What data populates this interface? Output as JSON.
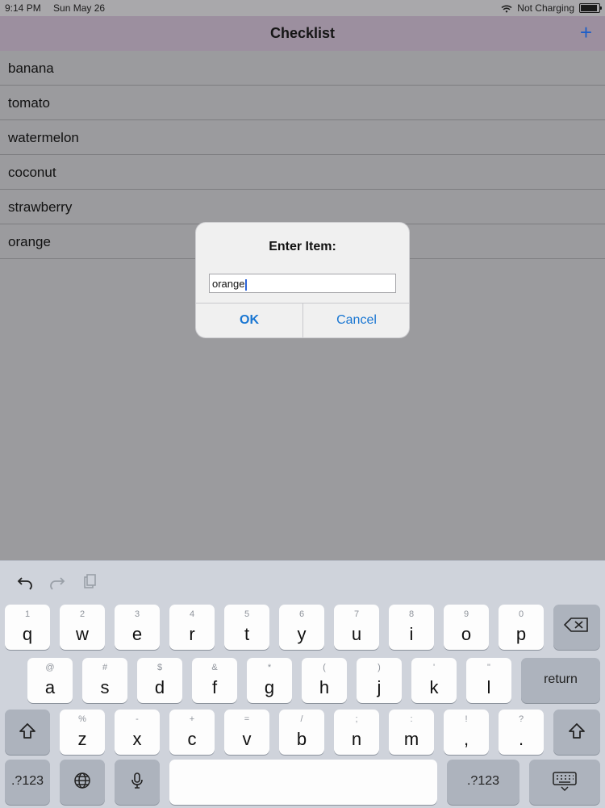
{
  "status": {
    "time": "9:14 PM",
    "date": "Sun May 26",
    "network": "Not Charging"
  },
  "nav": {
    "title": "Checklist",
    "add_label": "+"
  },
  "list": {
    "items": [
      "banana",
      "tomato",
      "watermelon",
      "coconut",
      "strawberry",
      "orange"
    ]
  },
  "dialog": {
    "title": "Enter Item:",
    "input_value": "orange",
    "ok_label": "OK",
    "cancel_label": "Cancel"
  },
  "keyboard": {
    "row1": [
      {
        "main": "q",
        "sub": "1"
      },
      {
        "main": "w",
        "sub": "2"
      },
      {
        "main": "e",
        "sub": "3"
      },
      {
        "main": "r",
        "sub": "4"
      },
      {
        "main": "t",
        "sub": "5"
      },
      {
        "main": "y",
        "sub": "6"
      },
      {
        "main": "u",
        "sub": "7"
      },
      {
        "main": "i",
        "sub": "8"
      },
      {
        "main": "o",
        "sub": "9"
      },
      {
        "main": "p",
        "sub": "0"
      }
    ],
    "row2": [
      {
        "main": "a",
        "sub": "@"
      },
      {
        "main": "s",
        "sub": "#"
      },
      {
        "main": "d",
        "sub": "$"
      },
      {
        "main": "f",
        "sub": "&"
      },
      {
        "main": "g",
        "sub": "*"
      },
      {
        "main": "h",
        "sub": "("
      },
      {
        "main": "j",
        "sub": ")"
      },
      {
        "main": "k",
        "sub": "'"
      },
      {
        "main": "l",
        "sub": "\""
      }
    ],
    "row3": [
      {
        "main": "z",
        "sub": "%"
      },
      {
        "main": "x",
        "sub": "-"
      },
      {
        "main": "c",
        "sub": "+"
      },
      {
        "main": "v",
        "sub": "="
      },
      {
        "main": "b",
        "sub": "/"
      },
      {
        "main": "n",
        "sub": ";"
      },
      {
        "main": "m",
        "sub": ":"
      },
      {
        "main": ",",
        "sub": "!"
      },
      {
        "main": ".",
        "sub": "?"
      }
    ],
    "return_label": "return",
    "num_label_left": ".?123",
    "num_label_right": ".?123"
  },
  "colors": {
    "accent": "#1976d2",
    "nav_bg": "#9c8f9f",
    "overlay_bg": "#9b9b9e",
    "keyboard_bg": "#cfd3db"
  },
  "icons": {
    "wifi": "wifi-icon",
    "battery": "battery-icon",
    "undo": "undo-icon",
    "redo": "redo-icon",
    "clipboard": "clipboard-icon",
    "backspace": "backspace-icon",
    "shift": "shift-icon",
    "globe": "globe-icon",
    "mic": "microphone-icon",
    "keyboard": "keyboard-dismiss-icon"
  }
}
